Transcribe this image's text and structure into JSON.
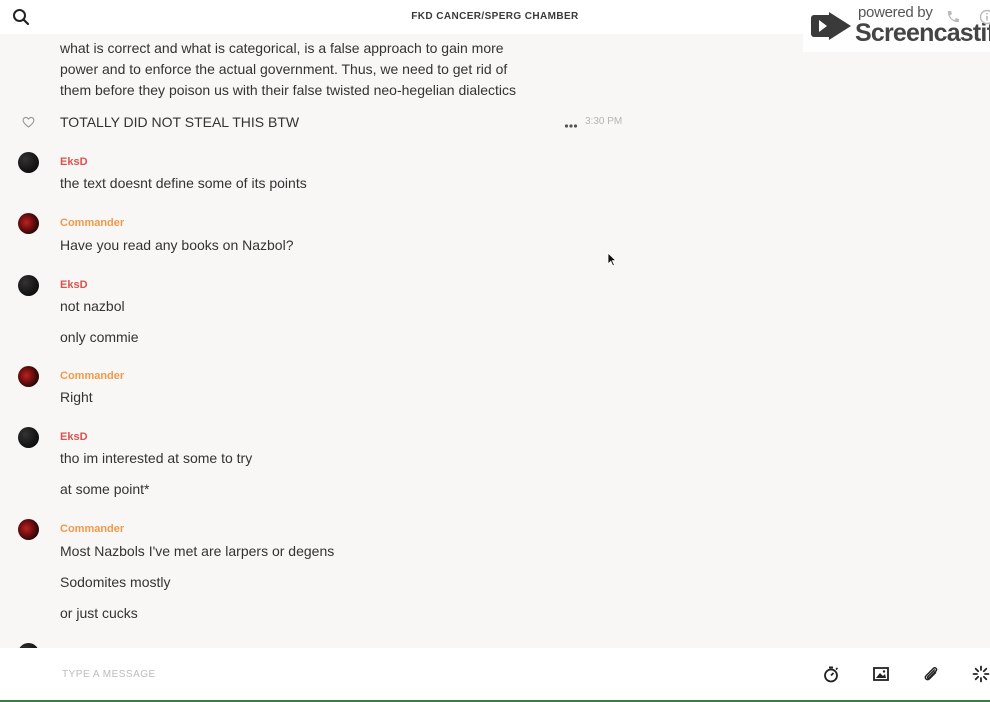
{
  "header": {
    "room_title": "FKD CANCER/SPERG CHAMBER"
  },
  "watermark": {
    "powered_by": "powered by",
    "brand": "Screencastify"
  },
  "feed": {
    "previous_lines": [
      "what is correct and what is categorical, is a false approach to gain more",
      "power and to enforce the actual government. Thus, we need to get rid of",
      "them before they poison us with their false twisted neo-hegelian dialectics"
    ],
    "last_line": "TOTALLY DID NOT STEAL THIS BTW",
    "last_time": "3:30 PM",
    "groups": [
      {
        "author": "EksD",
        "messages": [
          "the text doesnt define some of its points"
        ]
      },
      {
        "author": "Commander",
        "messages": [
          "Have you read any books on Nazbol?"
        ]
      },
      {
        "author": "EksD",
        "messages": [
          "not nazbol",
          "only commie"
        ]
      },
      {
        "author": "Commander",
        "messages": [
          "Right"
        ]
      },
      {
        "author": "EksD",
        "messages": [
          "tho im interested at some to try",
          "at some point*"
        ]
      },
      {
        "author": "Commander",
        "messages": [
          "Most Nazbols I've met are larpers or degens",
          "Sodomites mostly",
          "or just cucks"
        ]
      }
    ]
  },
  "composer": {
    "placeholder": "TYPE A MESSAGE"
  },
  "colors": {
    "eks_name": "#d9534f",
    "commander_name": "#ef9a4a",
    "accent_bar": "#3a7d44"
  }
}
